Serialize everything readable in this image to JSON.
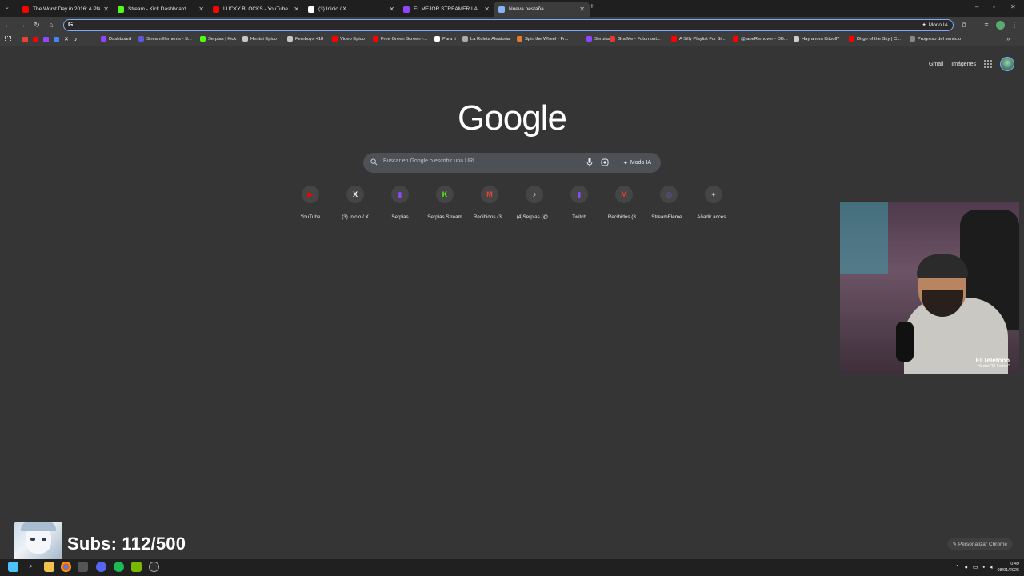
{
  "tabs": [
    {
      "title": "The Worst Day in 2016: A Playl...",
      "favicon": "youtube-icon",
      "color": "#ff0000",
      "active": false
    },
    {
      "title": "Stream - Kick Dashboard",
      "favicon": "kick-icon",
      "color": "#53fc18",
      "active": false
    },
    {
      "title": "LUCKY BLOCKS - YouTube",
      "favicon": "youtube-icon",
      "color": "#ff0000",
      "active": false
    },
    {
      "title": "(3) Inicio / X",
      "favicon": "x-icon",
      "color": "#ffffff",
      "active": false
    },
    {
      "title": "EL MEJOR STREAMER LA...",
      "favicon": "twitch-icon",
      "color": "#9146ff",
      "active": false
    },
    {
      "title": "Nueva pestaña",
      "favicon": "chrome-icon",
      "color": "#8ab4f8",
      "active": true
    }
  ],
  "omnibox": {
    "value": "",
    "modo_ia": "Modo IA"
  },
  "bookmarks": [
    {
      "label": "Dashboard",
      "color": "#9146ff"
    },
    {
      "label": "StreamElements - S...",
      "color": "#5b5bd6"
    },
    {
      "label": "Serpias | Kick",
      "color": "#53fc18"
    },
    {
      "label": "Hentai Epico",
      "color": "#c4c7c5"
    },
    {
      "label": "Femboys +18",
      "color": "#c4c7c5"
    },
    {
      "label": "Video Epico",
      "color": "#ff0000"
    },
    {
      "label": "Free Green Screen -...",
      "color": "#ff0000"
    },
    {
      "label": "Para ti",
      "color": "#ffffff"
    },
    {
      "label": "La Ruleta Aleatoria",
      "color": "#aaaaaa"
    },
    {
      "label": "Spin the Wheel - Fr...",
      "color": "#e07a2f"
    },
    {
      "label": "Serpias",
      "color": "#9146ff"
    },
    {
      "label": "GrafMe - Fotomont...",
      "color": "#e53935"
    },
    {
      "label": "A Silly Playlist For Si...",
      "color": "#ff0000"
    },
    {
      "label": "@janeRemover - OB...",
      "color": "#ff0000"
    },
    {
      "label": "Hay ahora Kitboll?",
      "color": "#cccccc"
    },
    {
      "label": "Dirge of the Sky | C...",
      "color": "#ff0000"
    },
    {
      "label": "Progreso del servicio",
      "color": "#888888"
    }
  ],
  "header": {
    "gmail": "Gmail",
    "images": "Imágenes"
  },
  "logo": "Google",
  "search": {
    "placeholder": "Buscar en Google o escribir una URL",
    "modo_ia": "Modo IA"
  },
  "shortcuts": [
    {
      "label": "YouTube",
      "icon": "youtube-icon",
      "color": "#ff0000"
    },
    {
      "label": "(3) Inicio / X",
      "icon": "x-icon",
      "color": "#ffffff"
    },
    {
      "label": "Serpias",
      "icon": "twitch-icon",
      "color": "#9146ff"
    },
    {
      "label": "Serpias Stream",
      "icon": "kick-icon",
      "color": "#53fc18"
    },
    {
      "label": "Recibidos (3...",
      "icon": "gmail-icon",
      "color": "#ea4335"
    },
    {
      "label": "(4)Serpias (@...",
      "icon": "tiktok-icon",
      "color": "#ffffff"
    },
    {
      "label": "Twitch",
      "icon": "twitch-icon",
      "color": "#9146ff"
    },
    {
      "label": "Recibidos (3...",
      "icon": "gmail-icon",
      "color": "#ea4335"
    },
    {
      "label": "StreamEleme...",
      "icon": "streamelements-icon",
      "color": "#5b5bd6"
    },
    {
      "label": "Añadir acces...",
      "icon": "plus-icon",
      "color": "#e8eaed"
    }
  ],
  "webcam": {
    "name": "El Teléfono",
    "subtitle": "Héctor \"El Father\""
  },
  "overlay": {
    "subs": "Subs: 112/500"
  },
  "personalize": "Personalizar Chrome",
  "clock": {
    "time": "0:49",
    "date": "08/01/2026"
  }
}
